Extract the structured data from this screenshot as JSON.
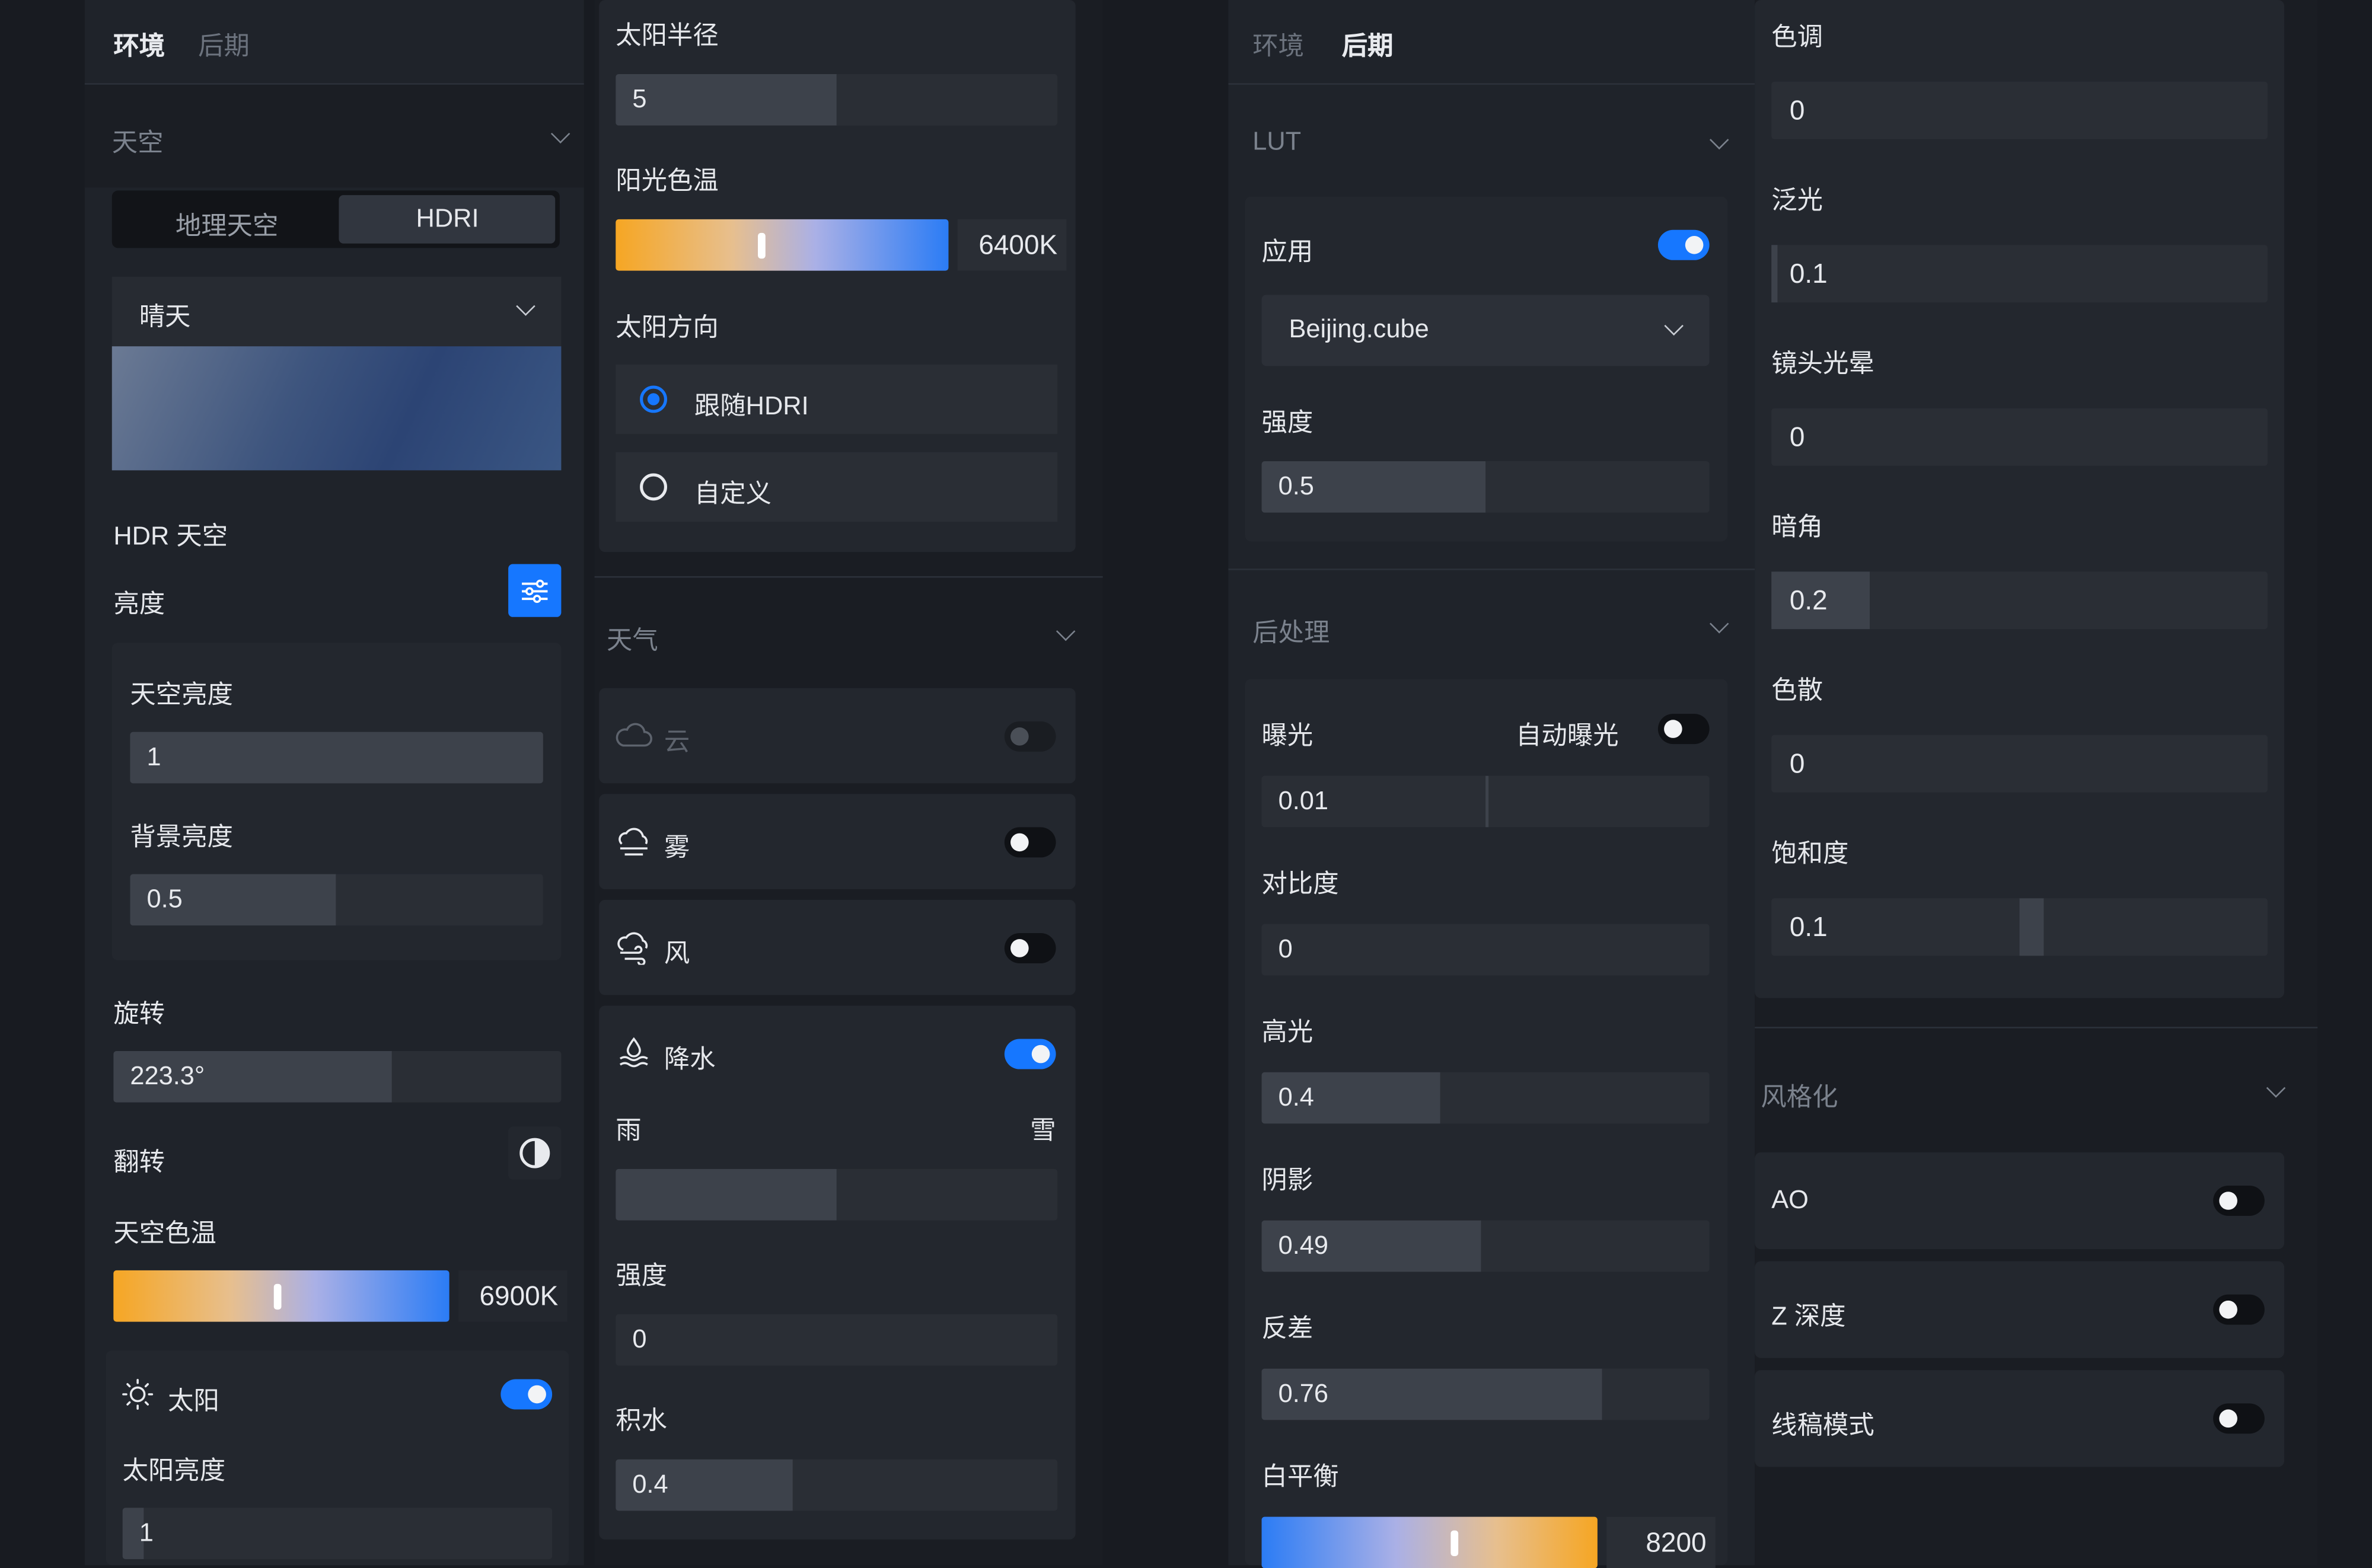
{
  "col1": {
    "tabs": [
      "环境",
      "后期"
    ],
    "sky_section": "天空",
    "sky_mode": {
      "options": [
        "地理天空",
        "HDRI"
      ],
      "selected": "HDRI"
    },
    "preset": "晴天",
    "hdr_sky_label": "HDR 天空",
    "brightness_label": "亮度",
    "sky_brightness_label": "天空亮度",
    "sky_brightness_value": "1",
    "bg_brightness_label": "背景亮度",
    "bg_brightness_value": "0.5",
    "rotation_label": "旋转",
    "rotation_value": "223.3°",
    "rotation_fraction": 0.62,
    "flip_label": "翻转",
    "sky_temp_label": "天空色温",
    "sky_temp_value": "6900K",
    "sun_label": "太阳",
    "sun_enabled": true,
    "sun_brightness_label": "太阳亮度",
    "sun_brightness_value": "1"
  },
  "col2": {
    "sun_radius_label": "太阳半径",
    "sun_radius_value": "5",
    "sun_radius_fraction": 0.5,
    "sun_temp_label": "阳光色温",
    "sun_temp_value": "6400K",
    "sun_dir_label": "太阳方向",
    "sun_dir_options": [
      "跟随HDRI",
      "自定义"
    ],
    "sun_dir_selected": "跟随HDRI",
    "weather_section": "天气",
    "weather_items": [
      {
        "label": "云",
        "icon": "cloud-icon",
        "enabled": false,
        "disabled": true
      },
      {
        "label": "雾",
        "icon": "fog-icon",
        "enabled": false
      },
      {
        "label": "风",
        "icon": "wind-icon",
        "enabled": false
      },
      {
        "label": "降水",
        "icon": "precipitation-icon",
        "enabled": true
      }
    ],
    "rain_label": "雨",
    "snow_label": "雪",
    "rain_snow_fraction": 0.5,
    "intensity_label": "强度",
    "intensity_value": "0",
    "puddle_label": "积水",
    "puddle_value": "0.4",
    "puddle_fraction": 0.4
  },
  "col3": {
    "tabs": [
      "环境",
      "后期"
    ],
    "lut_section": "LUT",
    "apply_label": "应用",
    "apply_enabled": true,
    "lut_file": "Beijing.cube",
    "lut_strength_label": "强度",
    "lut_strength_value": "0.5",
    "lut_strength_fraction": 0.5,
    "post_section": "后处理",
    "exposure_label": "曝光",
    "auto_exposure_label": "自动曝光",
    "auto_exposure_enabled": false,
    "exposure_value": "0.01",
    "exposure_fraction": 0.505,
    "contrast_label": "对比度",
    "contrast_value": "0",
    "highlight_label": "高光",
    "highlight_value": "0.4",
    "highlight_fraction": 0.4,
    "shadow_label": "阴影",
    "shadow_value": "0.49",
    "shadow_fraction": 0.49,
    "gamma_label": "反差",
    "gamma_value": "0.76",
    "gamma_fraction": 0.76,
    "wb_label": "白平衡",
    "wb_value": "8200"
  },
  "col4": {
    "hue_label": "色调",
    "hue_value": "0",
    "bloom_label": "泛光",
    "bloom_value": "0.1",
    "flare_label": "镜头光晕",
    "flare_value": "0",
    "vignette_label": "暗角",
    "vignette_value": "0.2",
    "vignette_fraction": 0.2,
    "aberration_label": "色散",
    "aberration_value": "0",
    "saturation_label": "饱和度",
    "saturation_value": "0.1",
    "style_section": "风格化",
    "style_items": [
      {
        "label": "AO",
        "enabled": false
      },
      {
        "label": "Z 深度",
        "enabled": false
      },
      {
        "label": "线稿模式",
        "enabled": false
      }
    ]
  },
  "colors": {
    "accent": "#1677ff",
    "panel": "#1f232a",
    "card": "#23272e",
    "bg": "#181b21"
  }
}
